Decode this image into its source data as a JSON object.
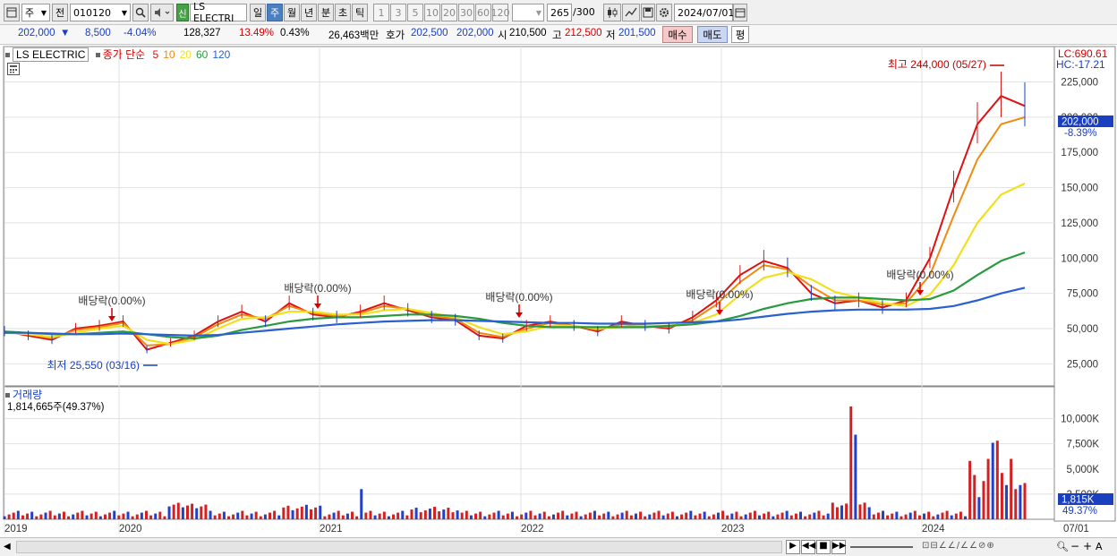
{
  "toolbar": {
    "market": "주",
    "compare": "전",
    "code": "010120",
    "new_badge": "신",
    "name": "LS ELECTRI",
    "periods": [
      "일",
      "주",
      "월",
      "년",
      "분",
      "초",
      "틱"
    ],
    "active_period": "주",
    "intervals": [
      "1",
      "3",
      "5",
      "10",
      "20",
      "30",
      "60",
      "120"
    ],
    "count": "265",
    "count_total": "/300",
    "date": "2024/07/01"
  },
  "info": {
    "price": "202,000",
    "change": "8,500",
    "change_pct": "-4.04%",
    "volume": "128,327",
    "turnover_pct": "13.49%",
    "vol_pct": "0.43%",
    "amount": "26,463백만",
    "quote_label": "호가",
    "ask": "202,500",
    "bid": "202,000",
    "open_label": "시",
    "open": "210,500",
    "high_label": "고",
    "high": "212,500",
    "low_label": "저",
    "low": "201,500",
    "buy": "매수",
    "sell": "매도",
    "avg": "평"
  },
  "price_panel": {
    "stock_name": "LS ELECTRIC",
    "ma_label": "종가 단순",
    "ma_periods": [
      "5",
      "10",
      "20",
      "60",
      "120"
    ],
    "ma_colors": [
      "#e01010",
      "#f08a10",
      "#f0e020",
      "#2a9a40",
      "#2a60d0"
    ],
    "lc": "LC:690.61",
    "hc": "HC:-17.21",
    "current_tag": "202,000",
    "current_pct": "-8.39%",
    "high_note": "최고 244,000 (05/27)",
    "low_note": "최저 25,550 (03/16)",
    "dividend_note": "배당락(0.00%)"
  },
  "volume_panel": {
    "title": "거래량",
    "value": "1,814,665주(49.37%)",
    "current_tag": "1,815K",
    "current_pct": "49.37%"
  },
  "chart_data": {
    "type": "candlestick",
    "price_axis": [
      "225,000",
      "200,000",
      "175,000",
      "150,000",
      "125,000",
      "100,000",
      "75,000",
      "50,000",
      "25,000"
    ],
    "price_range": [
      10000,
      245000
    ],
    "volume_axis": [
      "10,000K",
      "7,500K",
      "5,000K",
      "2,500K"
    ],
    "volume_range": [
      0,
      12000
    ],
    "x_labels": [
      "2019",
      "2020",
      "2021",
      "2022",
      "2023",
      "2024",
      "07/01"
    ],
    "series": [
      {
        "name": "5",
        "values": [
          48000,
          45000,
          42000,
          50000,
          52000,
          55000,
          35000,
          40000,
          45000,
          55000,
          62000,
          55000,
          68000,
          60000,
          58000,
          62000,
          68000,
          63000,
          58000,
          56000,
          45000,
          43000,
          52000,
          55000,
          52000,
          48000,
          55000,
          52000,
          50000,
          58000,
          70000,
          88000,
          98000,
          93000,
          75000,
          68000,
          70000,
          65000,
          70000,
          100000,
          150000,
          195000,
          215000,
          208000
        ]
      },
      {
        "name": "10",
        "values": [
          48000,
          46000,
          43000,
          49000,
          51000,
          54000,
          38000,
          39000,
          44000,
          53000,
          60000,
          57000,
          66000,
          61000,
          59000,
          61000,
          66000,
          64000,
          59000,
          57000,
          47000,
          44000,
          50000,
          54000,
          52000,
          49000,
          53000,
          52000,
          51000,
          56000,
          67000,
          83000,
          95000,
          92000,
          80000,
          70000,
          70000,
          67000,
          68000,
          88000,
          130000,
          170000,
          195000,
          200000
        ]
      },
      {
        "name": "20",
        "values": [
          47000,
          46000,
          44000,
          47000,
          50000,
          52000,
          42000,
          39000,
          42000,
          50000,
          57000,
          58000,
          62000,
          62000,
          60000,
          60000,
          63000,
          64000,
          61000,
          58000,
          51000,
          46000,
          48000,
          52000,
          52000,
          50000,
          51000,
          52000,
          52000,
          54000,
          60000,
          74000,
          86000,
          90000,
          85000,
          76000,
          72000,
          68000,
          66000,
          74000,
          95000,
          125000,
          145000,
          153000
        ]
      },
      {
        "name": "60",
        "values": [
          48000,
          47000,
          46000,
          46000,
          47000,
          48000,
          46000,
          44000,
          43000,
          45000,
          49000,
          52000,
          55000,
          57000,
          58000,
          58000,
          59000,
          60000,
          60000,
          59000,
          57000,
          54000,
          52000,
          51000,
          51000,
          51000,
          51000,
          51000,
          52000,
          53000,
          55000,
          59000,
          64000,
          68000,
          71000,
          72000,
          72000,
          71000,
          70000,
          71000,
          77000,
          88000,
          98000,
          104000
        ]
      },
      {
        "name": "120",
        "values": [
          47000,
          47000,
          46500,
          46000,
          46000,
          46500,
          46000,
          45500,
          45000,
          45500,
          47000,
          48500,
          50000,
          51500,
          53000,
          54000,
          55000,
          55500,
          56000,
          56000,
          55500,
          55000,
          54500,
          54000,
          54000,
          53500,
          53500,
          53500,
          54000,
          54500,
          55000,
          56500,
          58500,
          60500,
          62000,
          63000,
          63500,
          63500,
          63500,
          64000,
          66000,
          70000,
          75000,
          79000
        ]
      }
    ]
  }
}
